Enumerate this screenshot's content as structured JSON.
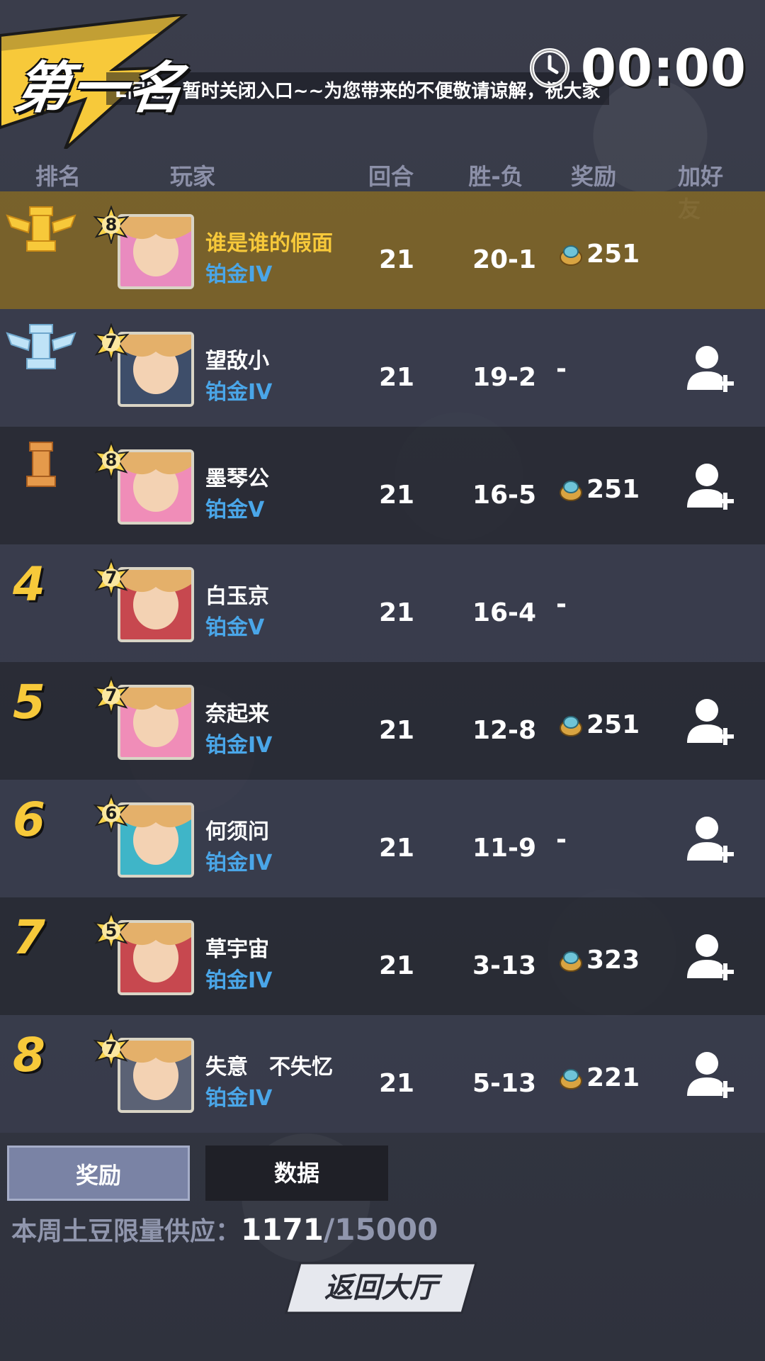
{
  "header": {
    "rank_title": "第一名",
    "notice": "E问题，暂时关闭入口~~为您带来的不便敬请谅解，祝大家",
    "timer": "00:00",
    "colors": {
      "banner": "#f7c93a",
      "accent_gold": "#f7c93a",
      "tier_blue": "#4aa6e8"
    }
  },
  "columns": {
    "rank": "排名",
    "player": "玩家",
    "rounds": "回合",
    "winloss": "胜-负",
    "reward": "奖励",
    "add_friend": "加好友"
  },
  "rows": [
    {
      "rank": "",
      "trophy": "gold-rook-trophy-icon",
      "level": "8",
      "name": "谁是谁的假面",
      "tier": "铂金IV",
      "rounds": "21",
      "winloss": "20-1",
      "reward": "251",
      "has_reward": true,
      "add_friend": false,
      "avatar_color": "#e98bbf"
    },
    {
      "rank": "",
      "trophy": "silver-rook-trophy-icon",
      "level": "7",
      "name": "望敌小",
      "tier": "铂金IV",
      "rounds": "21",
      "winloss": "19-2",
      "reward": "-",
      "has_reward": false,
      "add_friend": true,
      "avatar_color": "#3e4e6a"
    },
    {
      "rank": "",
      "trophy": "bronze-rook-trophy-icon",
      "level": "8",
      "name": "墨琴公",
      "tier": "铂金V",
      "rounds": "21",
      "winloss": "16-5",
      "reward": "251",
      "has_reward": true,
      "add_friend": true,
      "avatar_color": "#f08db8"
    },
    {
      "rank": "4",
      "trophy": "",
      "level": "7",
      "name": "白玉京",
      "tier": "铂金V",
      "rounds": "21",
      "winloss": "16-4",
      "reward": "-",
      "has_reward": false,
      "add_friend": false,
      "avatar_color": "#c7484f"
    },
    {
      "rank": "5",
      "trophy": "",
      "level": "7",
      "name": "奈起来",
      "tier": "铂金IV",
      "rounds": "21",
      "winloss": "12-8",
      "reward": "251",
      "has_reward": true,
      "add_friend": true,
      "avatar_color": "#f08db8"
    },
    {
      "rank": "6",
      "trophy": "",
      "level": "6",
      "name": "何须问",
      "tier": "铂金IV",
      "rounds": "21",
      "winloss": "11-9",
      "reward": "-",
      "has_reward": false,
      "add_friend": true,
      "avatar_color": "#3fb5c8"
    },
    {
      "rank": "7",
      "trophy": "",
      "level": "5",
      "name": "草宇宙",
      "tier": "铂金IV",
      "rounds": "21",
      "winloss": "3-13",
      "reward": "323",
      "has_reward": true,
      "add_friend": true,
      "avatar_color": "#c7484f"
    },
    {
      "rank": "8",
      "trophy": "",
      "level": "7",
      "name": "失意　不失忆",
      "tier": "铂金IV",
      "rounds": "21",
      "winloss": "5-13",
      "reward": "221",
      "has_reward": true,
      "add_friend": true,
      "avatar_color": "#5b6275"
    }
  ],
  "tabs": {
    "reward": "奖励",
    "data": "数据"
  },
  "supply": {
    "label": "本周土豆限量供应：",
    "current": "1171",
    "separator": "/",
    "max": "15000"
  },
  "back_button": "返回大厅"
}
